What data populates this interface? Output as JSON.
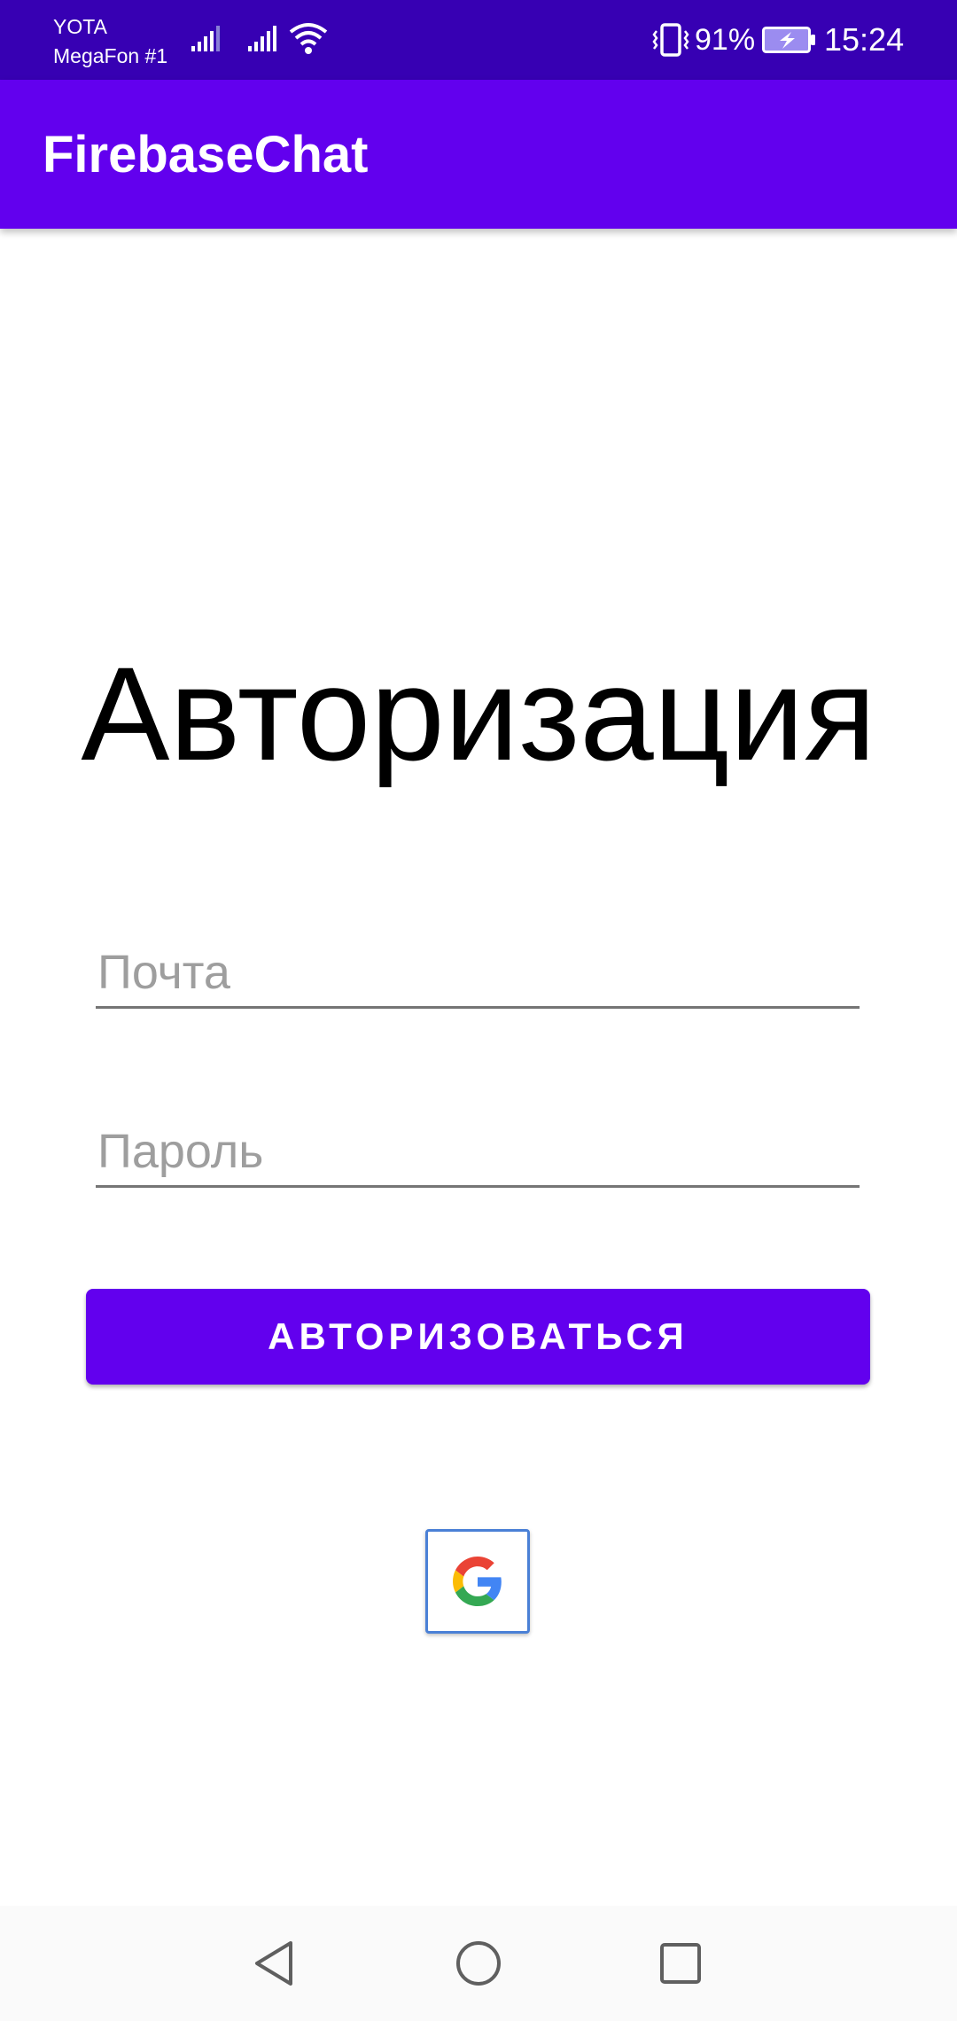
{
  "status_bar": {
    "carrier_1": "YOTA",
    "carrier_2": "MegaFon #1",
    "battery_percent": "91%",
    "time": "15:24",
    "icons": [
      "signal-icon",
      "signal-icon",
      "wifi-icon",
      "vibrate-icon",
      "battery-charging-icon"
    ]
  },
  "app_bar": {
    "title": "FirebaseChat"
  },
  "login": {
    "heading": "Авторизация",
    "email_placeholder": "Почта",
    "password_placeholder": "Пароль",
    "submit_label": "АВТОРИЗОВАТЬСЯ",
    "google_icon": "google-g-icon"
  },
  "nav_bar": {
    "icons": [
      "back-icon",
      "home-icon",
      "recents-icon"
    ]
  },
  "colors": {
    "status_bar": "#3700b3",
    "primary": "#6200ee",
    "google_border": "#4a80d6"
  }
}
